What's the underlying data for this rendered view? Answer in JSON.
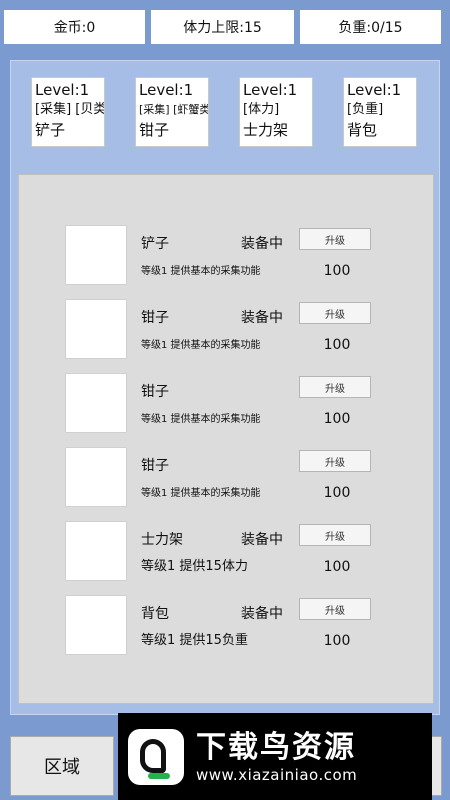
{
  "topbar": {
    "coins": "金币:0",
    "stamina": "体力上限:15",
    "load": "负重:0/15"
  },
  "tool_cards": [
    {
      "level": "Level:1",
      "tags": "[采集] [贝类]",
      "name": "铲子"
    },
    {
      "level": "Level:1",
      "tags": "[采集] [虾蟹类]",
      "name": "钳子"
    },
    {
      "level": "Level:1",
      "tags": "[体力]",
      "name": "士力架"
    },
    {
      "level": "Level:1",
      "tags": "[负重]",
      "name": "背包"
    }
  ],
  "items": [
    {
      "name": "铲子",
      "status": "装备中",
      "desc": "等级1 提供基本的采集功能",
      "upgrade": "升级",
      "cost": "100"
    },
    {
      "name": "钳子",
      "status": "装备中",
      "desc": "等级1 提供基本的采集功能",
      "upgrade": "升级",
      "cost": "100"
    },
    {
      "name": "钳子",
      "status": "",
      "desc": "等级1 提供基本的采集功能",
      "upgrade": "升级",
      "cost": "100"
    },
    {
      "name": "钳子",
      "status": "",
      "desc": "等级1 提供基本的采集功能",
      "upgrade": "升级",
      "cost": "100"
    },
    {
      "name": "士力架",
      "status": "装备中",
      "desc": "等级1 提供15体力",
      "upgrade": "升级",
      "cost": "100"
    },
    {
      "name": "背包",
      "status": "装备中",
      "desc": "等级1 提供15负重",
      "upgrade": "升级",
      "cost": "100"
    }
  ],
  "bottom_nav": {
    "area": "区域",
    "right": ""
  },
  "watermark": {
    "title": "下载鸟资源",
    "url": "www.xiazainiao.com"
  }
}
